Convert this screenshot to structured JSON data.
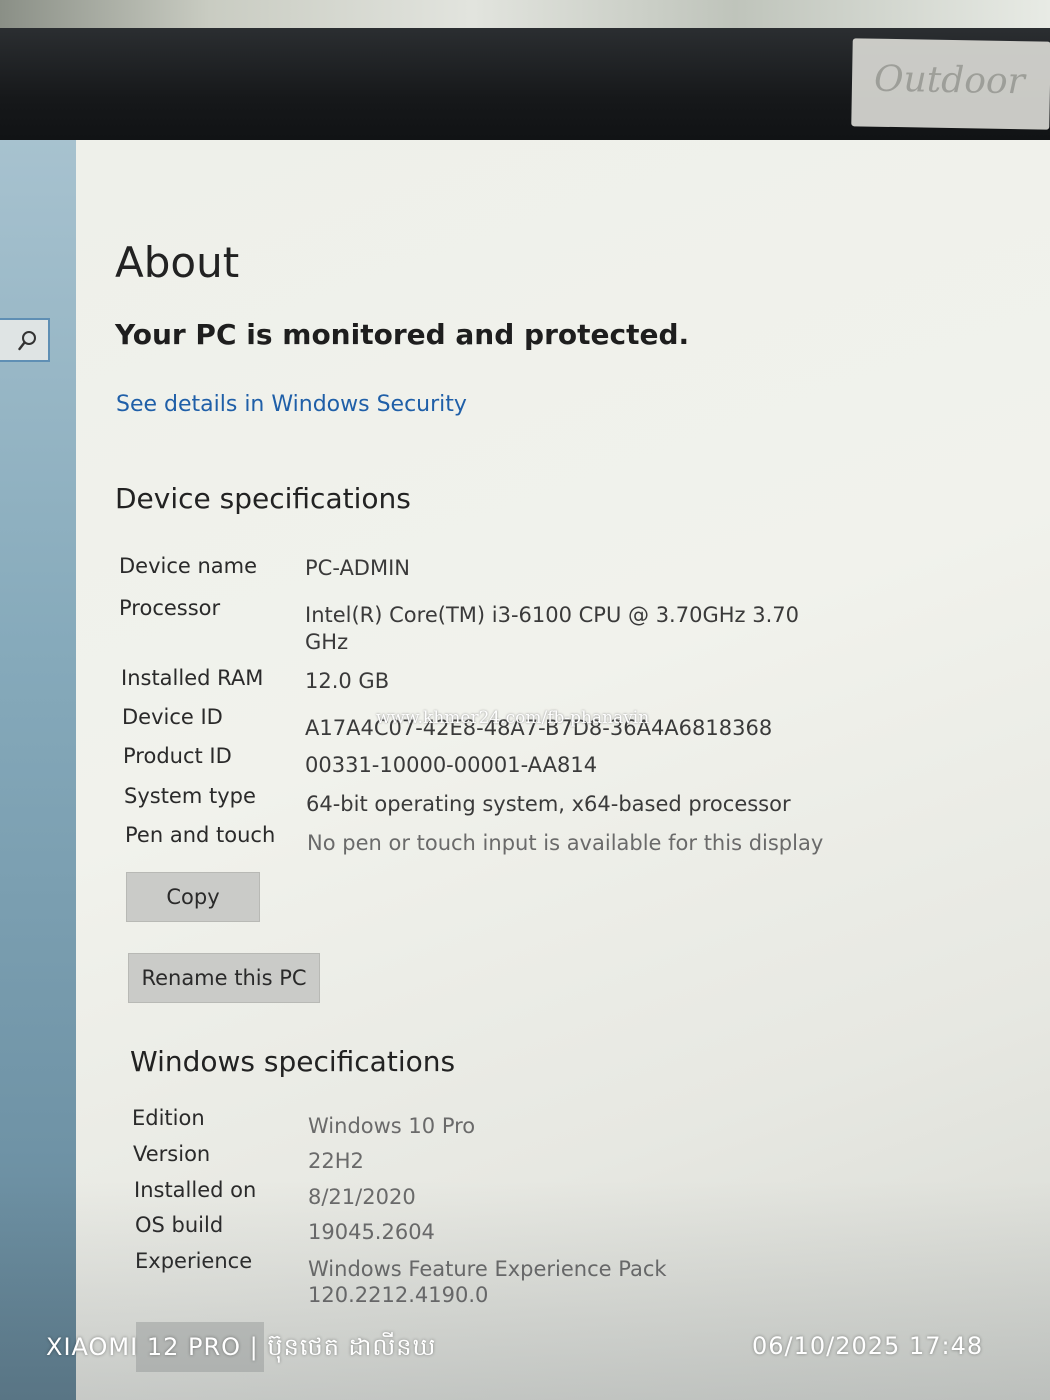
{
  "page": {
    "title": "About",
    "status_heading": "Your PC is monitored and protected.",
    "security_link": "See details in Windows Security"
  },
  "device_specs": {
    "heading": "Device specifications",
    "rows": [
      {
        "label": "Device name",
        "value": "PC-ADMIN"
      },
      {
        "label": "Processor",
        "value": "Intel(R) Core(TM) i3-6100 CPU @ 3.70GHz   3.70",
        "value2": "GHz"
      },
      {
        "label": "Installed RAM",
        "value": "12.0 GB"
      },
      {
        "label": "Device ID",
        "value": "A17A4C07-42E8-48A7-B7D8-36A4A6818368"
      },
      {
        "label": "Product ID",
        "value": "00331-10000-00001-AA814"
      },
      {
        "label": "System type",
        "value": "64-bit operating system, x64-based processor"
      },
      {
        "label": "Pen and touch",
        "value": "No pen or touch input is available for this display"
      }
    ],
    "copy_label": "Copy",
    "rename_label": "Rename this PC"
  },
  "windows_specs": {
    "heading": "Windows specifications",
    "rows": [
      {
        "label": "Edition",
        "value": "Windows 10 Pro"
      },
      {
        "label": "Version",
        "value": "22H2"
      },
      {
        "label": "Installed on",
        "value": "8/21/2020"
      },
      {
        "label": "OS build",
        "value": "19045.2604"
      },
      {
        "label": "Experience",
        "value": "Windows Feature Experience Pack",
        "value2": "120.2212.4190.0"
      }
    ]
  },
  "overlays": {
    "watermark": "www.khmer24.com/fb-phanavin",
    "camera_stamp": "XIAOMI 12 PRO | ប៊ុនថេត ដាលីនឃ",
    "datetime_stamp": "06/10/2025 17:48",
    "sticker_text": "Outdoor"
  },
  "icons": {
    "search": "search-icon"
  },
  "colors": {
    "link": "#1f5fa8",
    "sidebar": "#86aabb",
    "button": "#cacbc8"
  }
}
